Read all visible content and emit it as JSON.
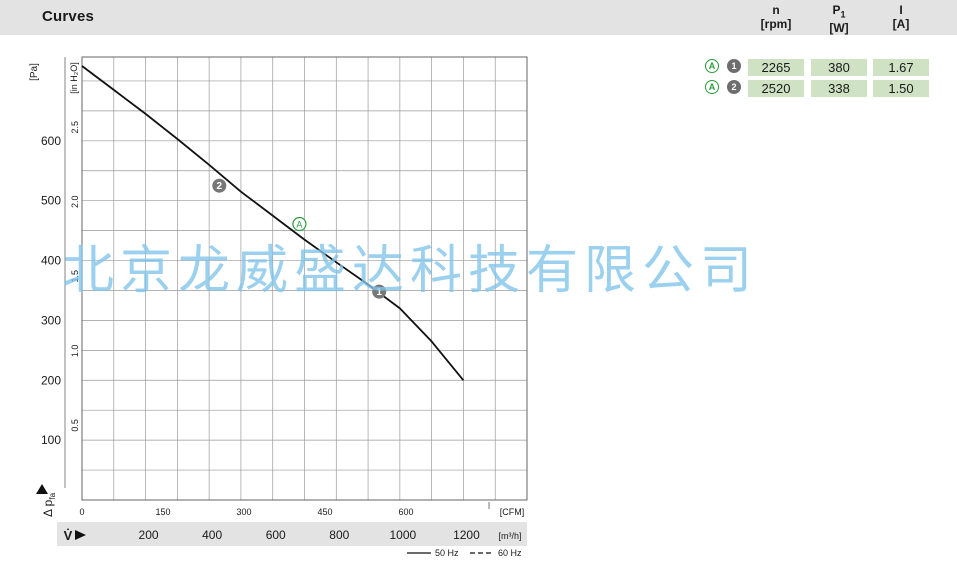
{
  "header": {
    "title": "Curves",
    "columns": [
      {
        "symbol": "n",
        "sub": "",
        "unit": "[rpm]"
      },
      {
        "symbol": "P",
        "sub": "1",
        "unit": "[W]"
      },
      {
        "symbol": "I",
        "sub": "",
        "unit": "[A]"
      }
    ]
  },
  "operating_points": [
    {
      "curve": "A",
      "point": "1",
      "n": "2265",
      "p1": "380",
      "i": "1.67"
    },
    {
      "curve": "A",
      "point": "2",
      "n": "2520",
      "p1": "338",
      "i": "1.50"
    }
  ],
  "colors": {
    "header_bg": "#e3e3e3",
    "cell_bg": "#cfe3c4",
    "accent_green": "#2e9a3e",
    "badge_grey": "#6e6e6e",
    "watermark": "#7fc4ea"
  },
  "watermark": "北京龙威盛达科技有限公司",
  "chart_data": {
    "type": "line",
    "grid": true,
    "x_axis": {
      "unit_m3h": "[m³/h]",
      "unit_cfm": "[CFM]",
      "symbol": "V̇",
      "ticks_m3h": [
        200,
        400,
        600,
        800,
        1000,
        1200
      ],
      "ticks_cfm": [
        0,
        150,
        300,
        450,
        600
      ],
      "range_m3h": [
        0,
        1400
      ]
    },
    "y_axis": {
      "unit_pa": "[Pa]",
      "unit_inh2o": "[in H₂O]",
      "symbol": "Δ p",
      "symbol_sub": "fa",
      "ticks_pa": [
        100,
        200,
        300,
        400,
        500,
        600
      ],
      "ticks_inh2o": [
        "0.5",
        "1.0",
        "1.5",
        "2.0",
        "2.5"
      ],
      "range_pa": [
        0,
        740
      ]
    },
    "series": [
      {
        "name": "50 Hz",
        "line_style": "solid",
        "x": [
          0,
          100,
          200,
          300,
          400,
          500,
          600,
          700,
          800,
          900,
          1000,
          1100,
          1200
        ],
        "y": [
          725,
          685,
          645,
          603,
          560,
          515,
          475,
          435,
          397,
          360,
          320,
          265,
          200
        ]
      }
    ],
    "markers": [
      {
        "label": "1",
        "x": 935,
        "y": 348,
        "style": "filled"
      },
      {
        "label": "2",
        "x": 432,
        "y": 525,
        "style": "filled"
      },
      {
        "label": "A",
        "x": 684,
        "y": 461,
        "style": "outline"
      }
    ],
    "legend": [
      {
        "label": "50 Hz",
        "style": "solid"
      },
      {
        "label": "60 Hz",
        "style": "dashed"
      }
    ],
    "legend_position": "bottom-right"
  }
}
